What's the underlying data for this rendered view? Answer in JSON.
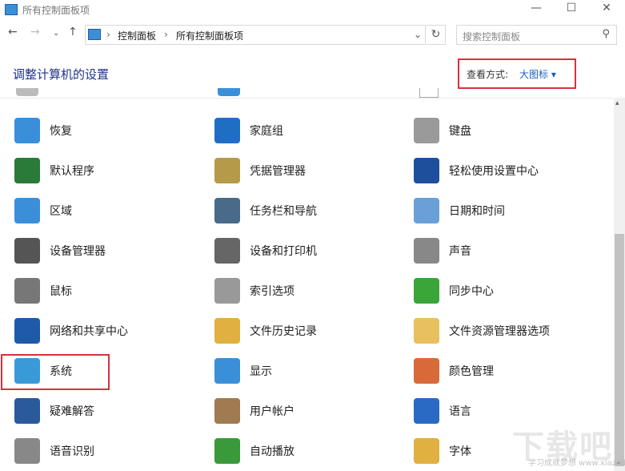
{
  "window": {
    "title": "所有控制面板项",
    "minimize": "—",
    "maximize": "☐",
    "close": "✕"
  },
  "nav": {
    "back": "←",
    "forward": "→",
    "recent": "⌄",
    "up": "↑"
  },
  "address": {
    "crumbs": [
      "控制面板",
      "所有控制面板项"
    ],
    "sep": "›",
    "dropdown": "⌄",
    "refresh": "↻"
  },
  "search": {
    "placeholder": "搜索控制面板",
    "icon": "⚲"
  },
  "heading": "调整计算机的设置",
  "view": {
    "label": "查看方式:",
    "value": "大图标 ▾"
  },
  "items": [
    {
      "label": "恢复",
      "color": "#3a8fd8"
    },
    {
      "label": "家庭组",
      "color": "#1e6fc4"
    },
    {
      "label": "键盘",
      "color": "#9a9a9a"
    },
    {
      "label": "默认程序",
      "color": "#2a7a3a"
    },
    {
      "label": "凭据管理器",
      "color": "#b59a4a"
    },
    {
      "label": "轻松使用设置中心",
      "color": "#1d4f9c"
    },
    {
      "label": "区域",
      "color": "#3a8fd8"
    },
    {
      "label": "任务栏和导航",
      "color": "#4a6a8a"
    },
    {
      "label": "日期和时间",
      "color": "#6aa0d8"
    },
    {
      "label": "设备管理器",
      "color": "#555555"
    },
    {
      "label": "设备和打印机",
      "color": "#666666"
    },
    {
      "label": "声音",
      "color": "#888888"
    },
    {
      "label": "鼠标",
      "color": "#777777"
    },
    {
      "label": "索引选项",
      "color": "#999999"
    },
    {
      "label": "同步中心",
      "color": "#3aa63a"
    },
    {
      "label": "网络和共享中心",
      "color": "#1e5aa8"
    },
    {
      "label": "文件历史记录",
      "color": "#e0b040"
    },
    {
      "label": "文件资源管理器选项",
      "color": "#e8c060"
    },
    {
      "label": "系统",
      "color": "#3a9ad8"
    },
    {
      "label": "显示",
      "color": "#3a8fd8"
    },
    {
      "label": "颜色管理",
      "color": "#d86a3a"
    },
    {
      "label": "疑难解答",
      "color": "#2a5a9a"
    },
    {
      "label": "用户帐户",
      "color": "#a07a50"
    },
    {
      "label": "语言",
      "color": "#2a6ac4"
    },
    {
      "label": "语音识别",
      "color": "#888888"
    },
    {
      "label": "自动播放",
      "color": "#3a9a3a"
    },
    {
      "label": "字体",
      "color": "#e0b040"
    }
  ],
  "watermark": {
    "brand": "下载吧",
    "slogan": "学习成就梦想 www.xiazaiba.com"
  },
  "scrollbar": {
    "up": "▴",
    "down": "⌄"
  }
}
